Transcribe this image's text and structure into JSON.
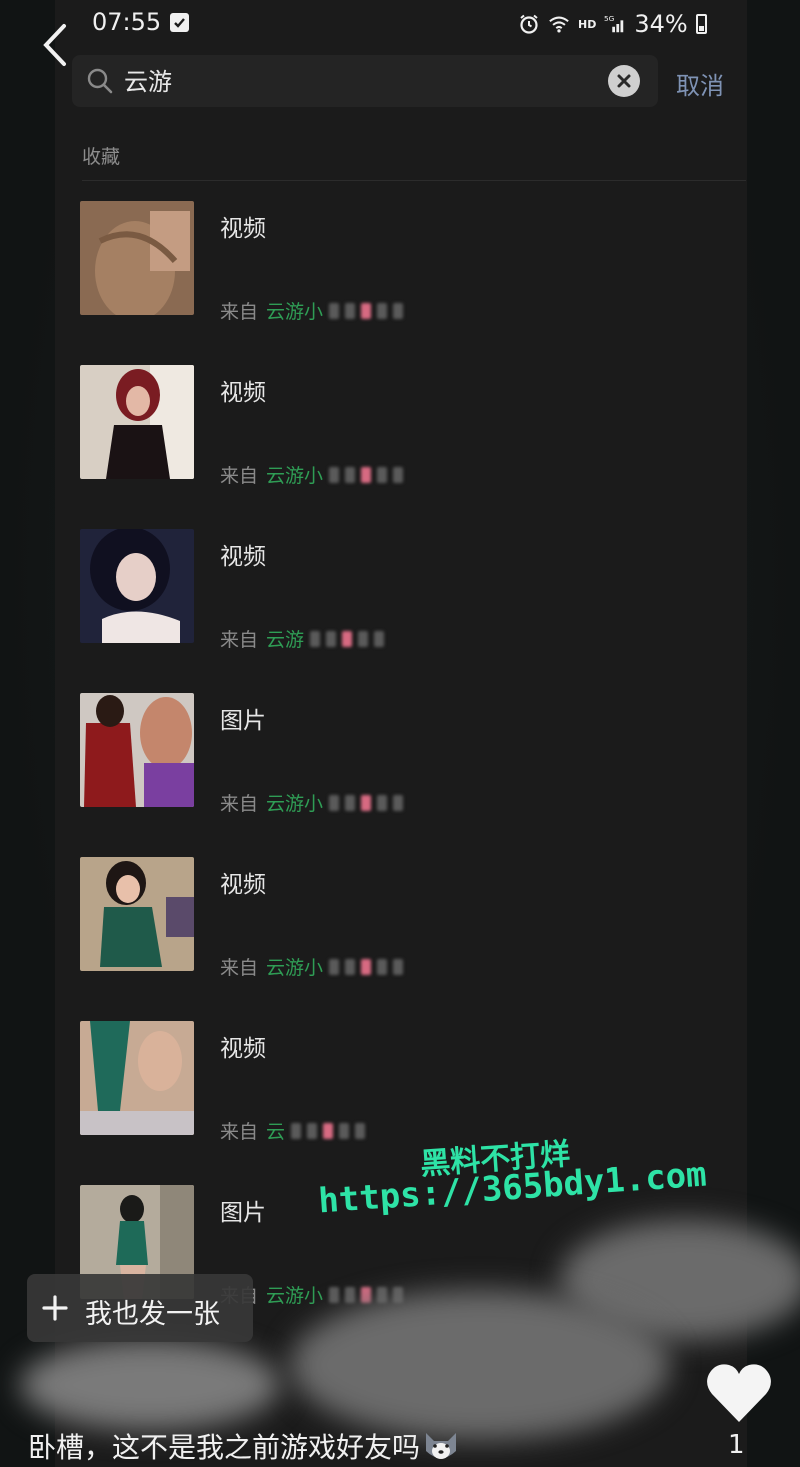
{
  "status_bar": {
    "time": "07:55",
    "network": "HD",
    "signal": "5G",
    "battery": "34%"
  },
  "search": {
    "query": "云游",
    "cancel": "取消"
  },
  "section_label": "收藏",
  "items": [
    {
      "type": "视频",
      "source_prefix": "来自",
      "source_name": "云游小"
    },
    {
      "type": "视频",
      "source_prefix": "来自",
      "source_name": "云游小"
    },
    {
      "type": "视频",
      "source_prefix": "来自",
      "source_name": "云游"
    },
    {
      "type": "图片",
      "source_prefix": "来自",
      "source_name": "云游小"
    },
    {
      "type": "视频",
      "source_prefix": "来自",
      "source_name": "云游小"
    },
    {
      "type": "视频",
      "source_prefix": "来自",
      "source_name": "云"
    },
    {
      "type": "图片",
      "source_prefix": "来自",
      "source_name": "云游小"
    }
  ],
  "overlay_button": {
    "label": "我也发一张"
  },
  "watermark": {
    "line1": "黑料不打烊",
    "line2": "https://365bdy1.com"
  },
  "comment": {
    "text": "卧槽，这不是我之前游戏好友吗"
  },
  "likes": {
    "count": "1"
  },
  "colors": {
    "accent_green": "#2f9d55",
    "cancel_blue": "#7f93b5",
    "watermark": "#2ee3a6",
    "background": "#1b1b1b"
  }
}
